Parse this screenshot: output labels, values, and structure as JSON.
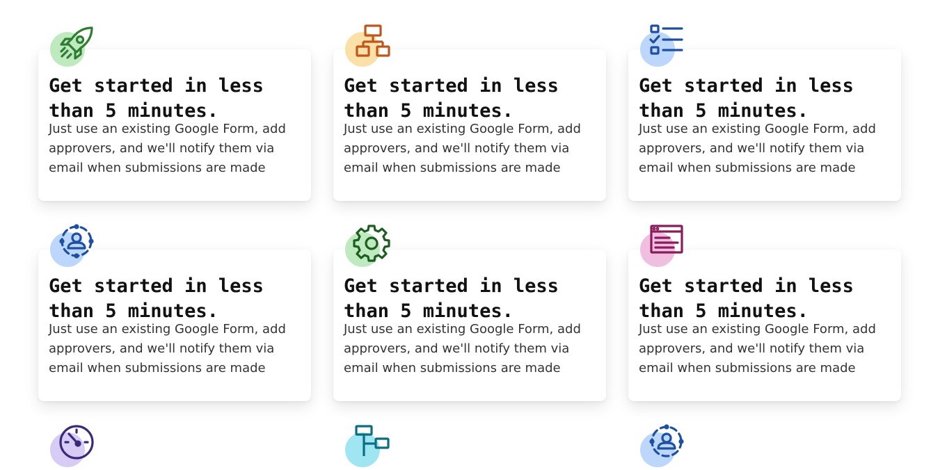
{
  "cards": [
    {
      "title": "Get started in less than 5 minutes.",
      "description": "Just use an existing Google Form, add approvers, and we'll notify them via email when submissions are made",
      "icon": "rocket-icon",
      "icon_color": "#2e7d32",
      "blob_color": "#bfeac0"
    },
    {
      "title": "Get started in less than 5 minutes.",
      "description": "Just use an existing Google Form, add approvers, and we'll notify them via email when submissions are made",
      "icon": "org-chart-icon",
      "icon_color": "#c0561b",
      "blob_color": "#fbe0a8"
    },
    {
      "title": "Get started in less than 5 minutes.",
      "description": "Just use an existing Google Form, add approvers, and we'll notify them via email when submissions are made",
      "icon": "checklist-icon",
      "icon_color": "#1e4fa3",
      "blob_color": "#bcd7fb"
    },
    {
      "title": "Get started in less than 5 minutes.",
      "description": "Just use an existing Google Form, add approvers, and we'll notify them via email when submissions are made",
      "icon": "person-target-icon",
      "icon_color": "#1e4fa3",
      "blob_color": "#bcd7fb"
    },
    {
      "title": "Get started in less than 5 minutes.",
      "description": "Just use an existing Google Form, add approvers, and we'll notify them via email when submissions are made",
      "icon": "gear-icon",
      "icon_color": "#1b5e20",
      "blob_color": "#bfeac0"
    },
    {
      "title": "Get started in less than 5 minutes.",
      "description": "Just use an existing Google Form, add approvers, and we'll notify them via email when submissions are made",
      "icon": "browser-window-icon",
      "icon_color": "#8a1c5c",
      "blob_color": "#f0bfe0"
    }
  ],
  "partial_icons": [
    {
      "icon": "speedometer-icon",
      "icon_color": "#3b2a7a",
      "blob_color": "#d6ccf5"
    },
    {
      "icon": "flowchart-icon",
      "icon_color": "#0b6f80",
      "blob_color": "#9fe6f2"
    },
    {
      "icon": "person-target-icon",
      "icon_color": "#1e4fa3",
      "blob_color": "#bcd7fb"
    }
  ]
}
